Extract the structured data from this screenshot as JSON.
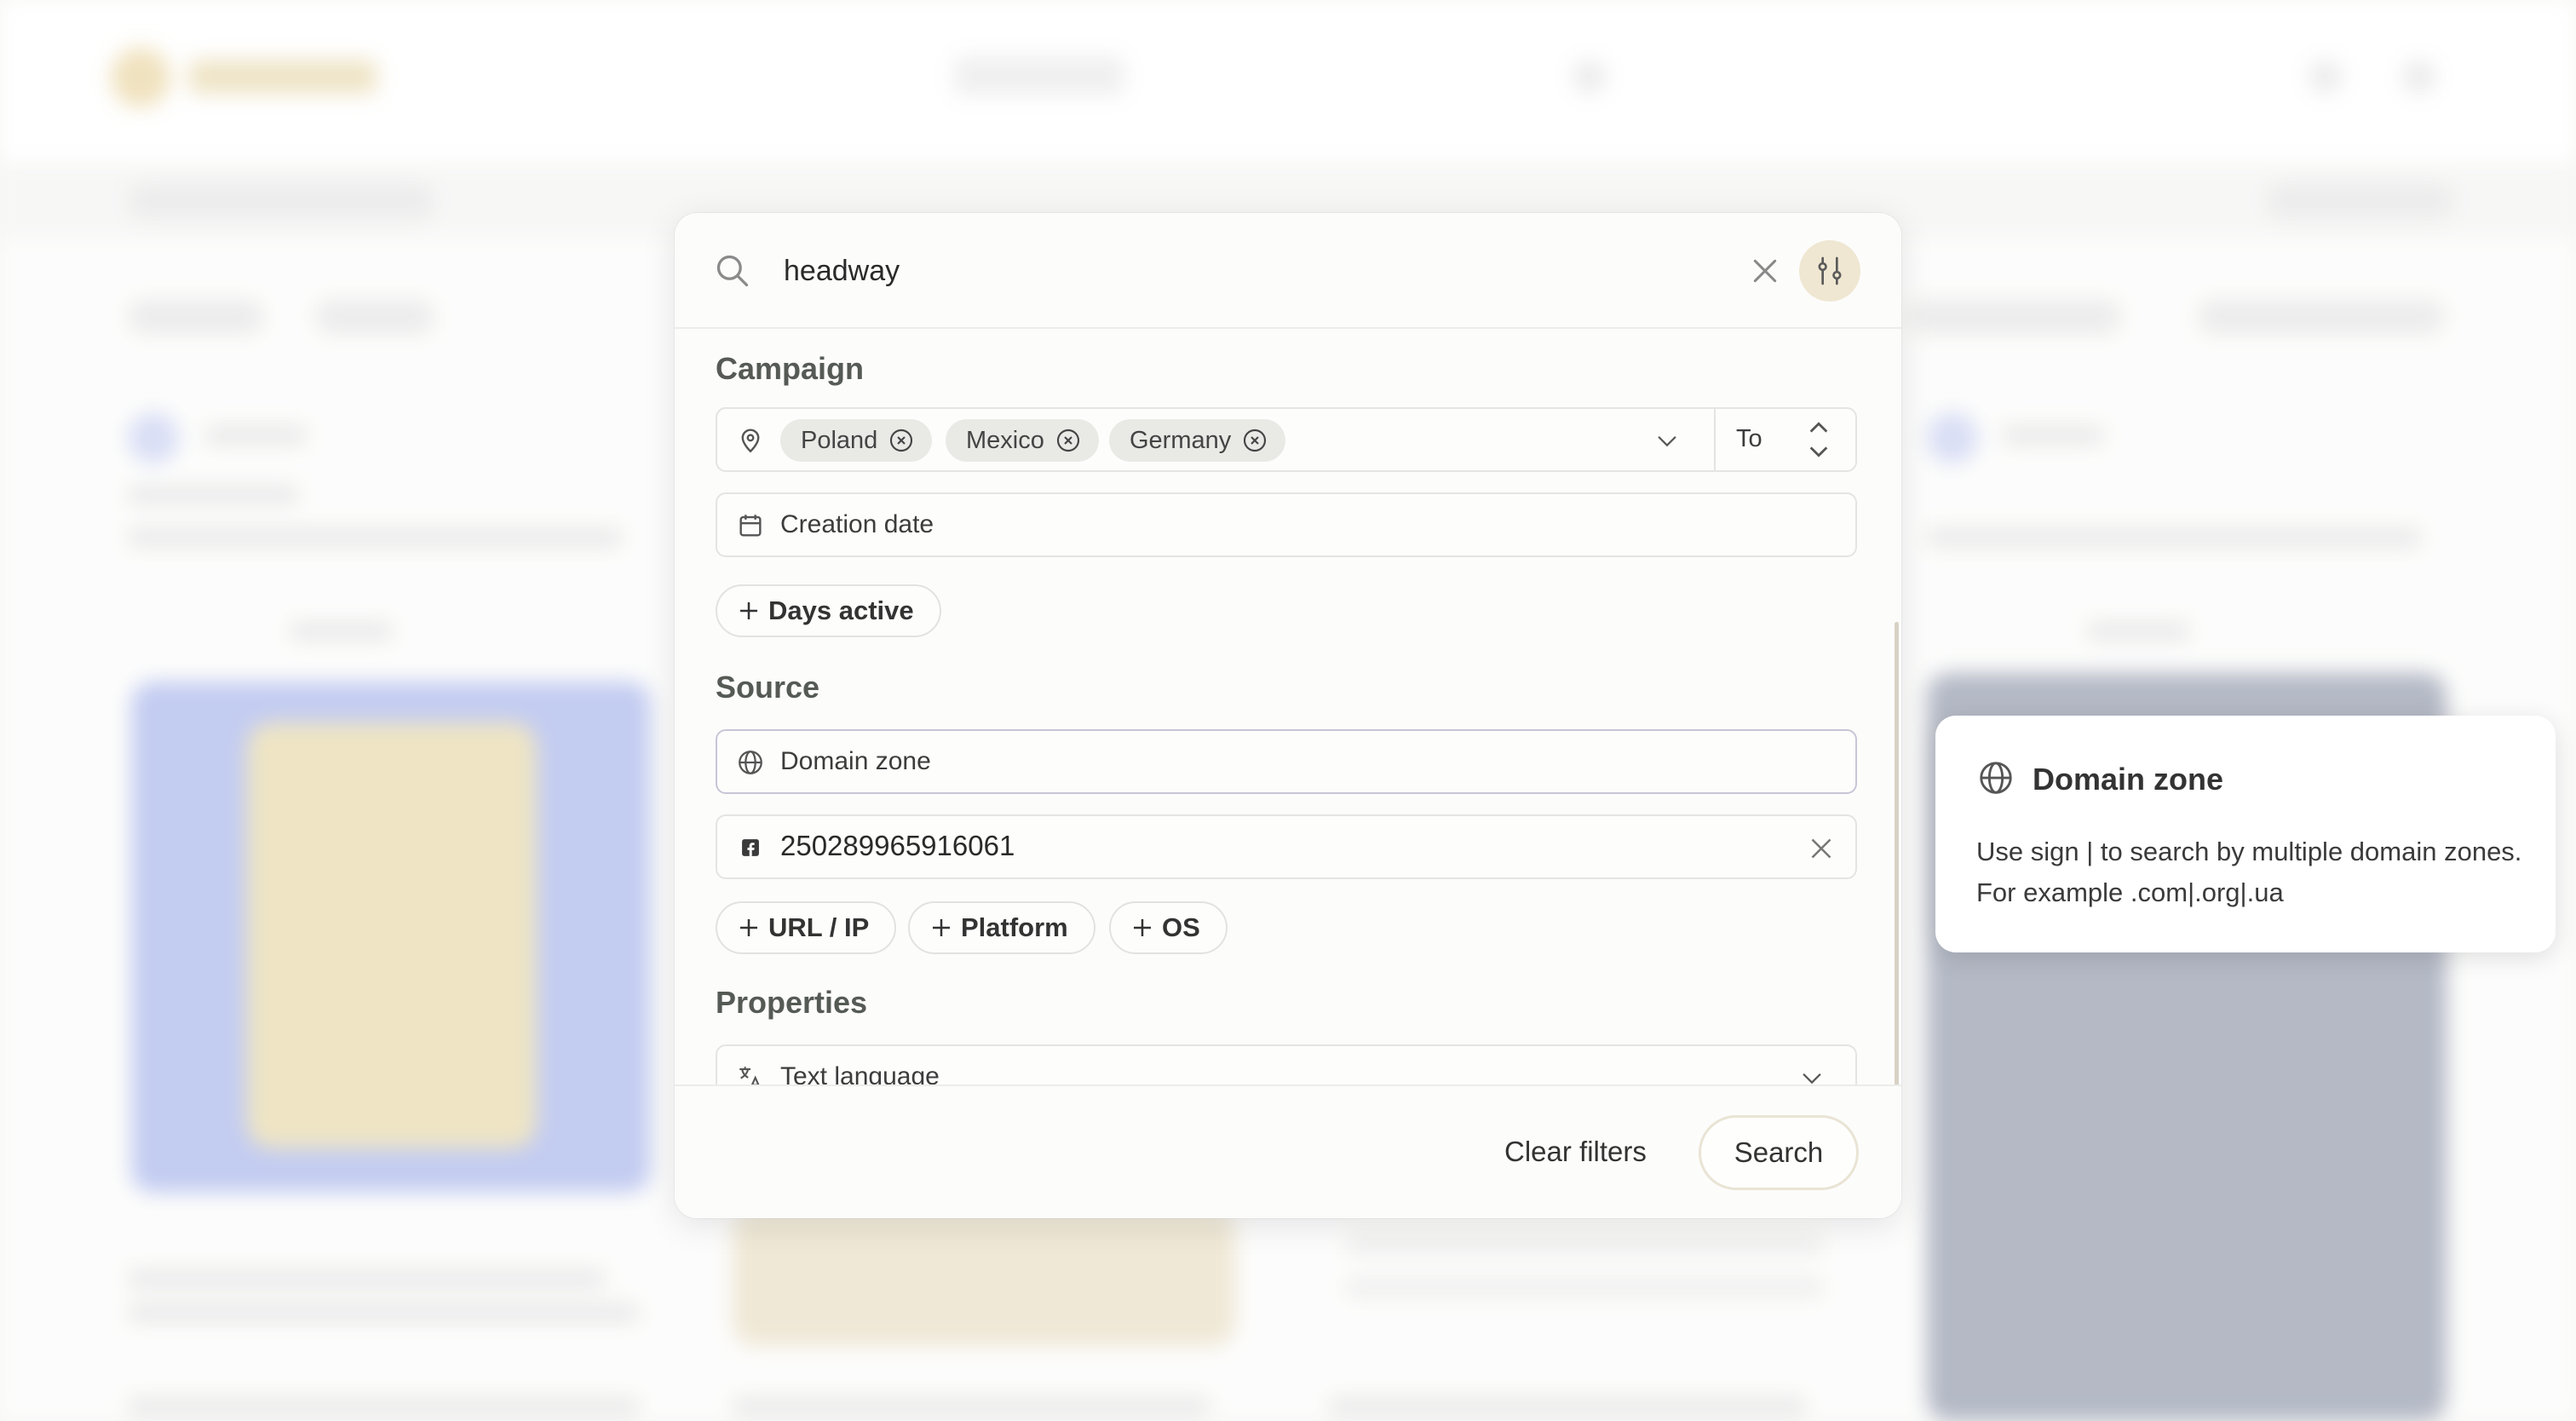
{
  "search": {
    "value": "headway",
    "placeholder": ""
  },
  "campaign": {
    "title": "Campaign",
    "geo_chips": [
      "Poland",
      "Mexico",
      "Germany"
    ],
    "geo_to_label": "To",
    "creation_date_placeholder": "Creation date",
    "days_active_label": "Days active"
  },
  "source": {
    "title": "Source",
    "domain_zone_placeholder": "Domain zone",
    "facebook_id_value": "250289965916061",
    "url_ip_label": "URL / IP",
    "platform_label": "Platform",
    "os_label": "OS"
  },
  "properties": {
    "title": "Properties",
    "text_language_placeholder": "Text language"
  },
  "footer": {
    "clear_label": "Clear filters",
    "search_label": "Search"
  },
  "tooltip": {
    "title": "Domain zone",
    "body": "Use sign | to search by multiple domain zones. For example .com|.org|.ua"
  },
  "colors": {
    "accent": "#efe7d2",
    "chip_bg": "#e9e9e6",
    "border": "#e4e4e2"
  }
}
